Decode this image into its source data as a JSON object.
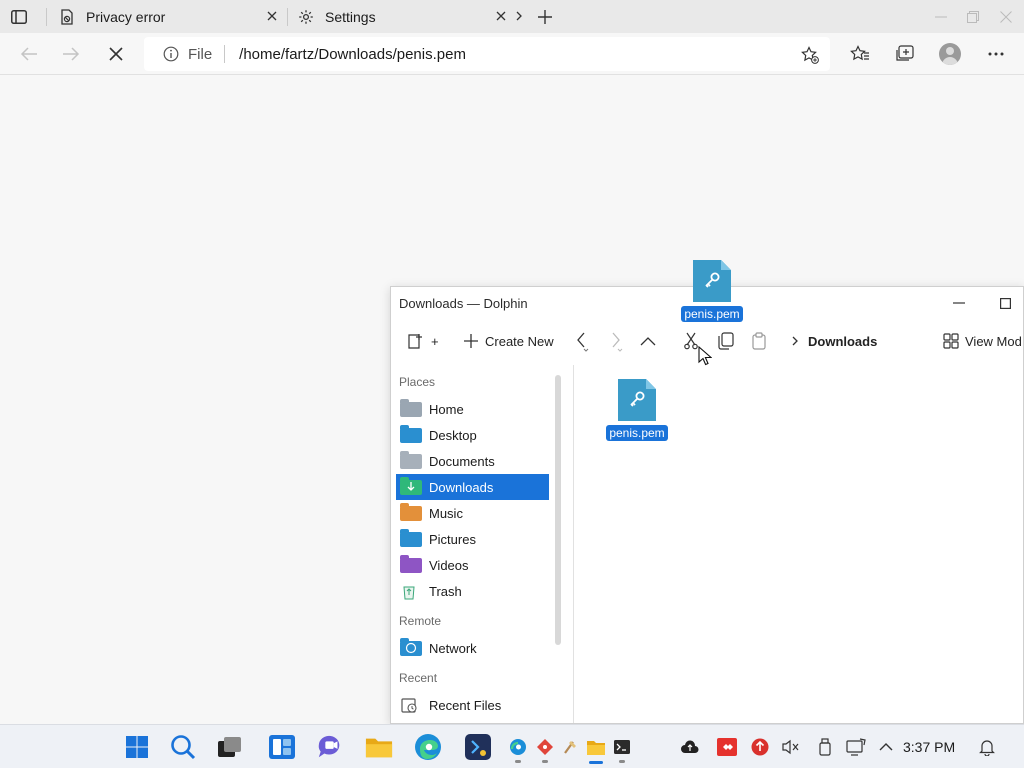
{
  "browser": {
    "tabs": [
      {
        "title": "Privacy error",
        "icon": "privacy-error-icon"
      },
      {
        "title": "Settings",
        "icon": "gear-icon"
      }
    ],
    "address": {
      "scheme": "File",
      "url": "/home/fartz/Downloads/penis.pem"
    }
  },
  "drag": {
    "file_name": "penis.pem"
  },
  "dolphin": {
    "title": "Downloads — Dolphin",
    "toolbar": {
      "new_tab_label": "+",
      "create_new_label": "Create New",
      "breadcrumb_current": "Downloads",
      "view_mode_label": "View Mod"
    },
    "places": {
      "heading": "Places",
      "items": [
        {
          "label": "Home",
          "icon": "home-folder-icon",
          "color": "#9aa6b2"
        },
        {
          "label": "Desktop",
          "icon": "desktop-folder-icon",
          "color": "#2a8fd0"
        },
        {
          "label": "Documents",
          "icon": "documents-folder-icon",
          "color": "#a7b0ba"
        },
        {
          "label": "Downloads",
          "icon": "downloads-folder-icon",
          "color": "#2fb87a",
          "selected": true
        },
        {
          "label": "Music",
          "icon": "music-folder-icon",
          "color": "#e3903a"
        },
        {
          "label": "Pictures",
          "icon": "pictures-folder-icon",
          "color": "#2a8fd0"
        },
        {
          "label": "Videos",
          "icon": "videos-folder-icon",
          "color": "#8e55c4"
        },
        {
          "label": "Trash",
          "icon": "trash-icon",
          "color": "#3aa77a"
        }
      ],
      "remote_heading": "Remote",
      "remote_items": [
        {
          "label": "Network",
          "icon": "network-icon",
          "color": "#2a8fd0"
        }
      ],
      "recent_heading": "Recent",
      "recent_items": [
        {
          "label": "Recent Files",
          "icon": "recent-files-icon",
          "color": "#555555"
        }
      ]
    },
    "files": [
      {
        "name": "penis.pem",
        "icon": "key-file-icon",
        "selected": true
      }
    ]
  },
  "taskbar": {
    "clock": "3:37 PM"
  },
  "colors": {
    "accent": "#1a73d9",
    "file_icon": "#3a9bc8"
  }
}
